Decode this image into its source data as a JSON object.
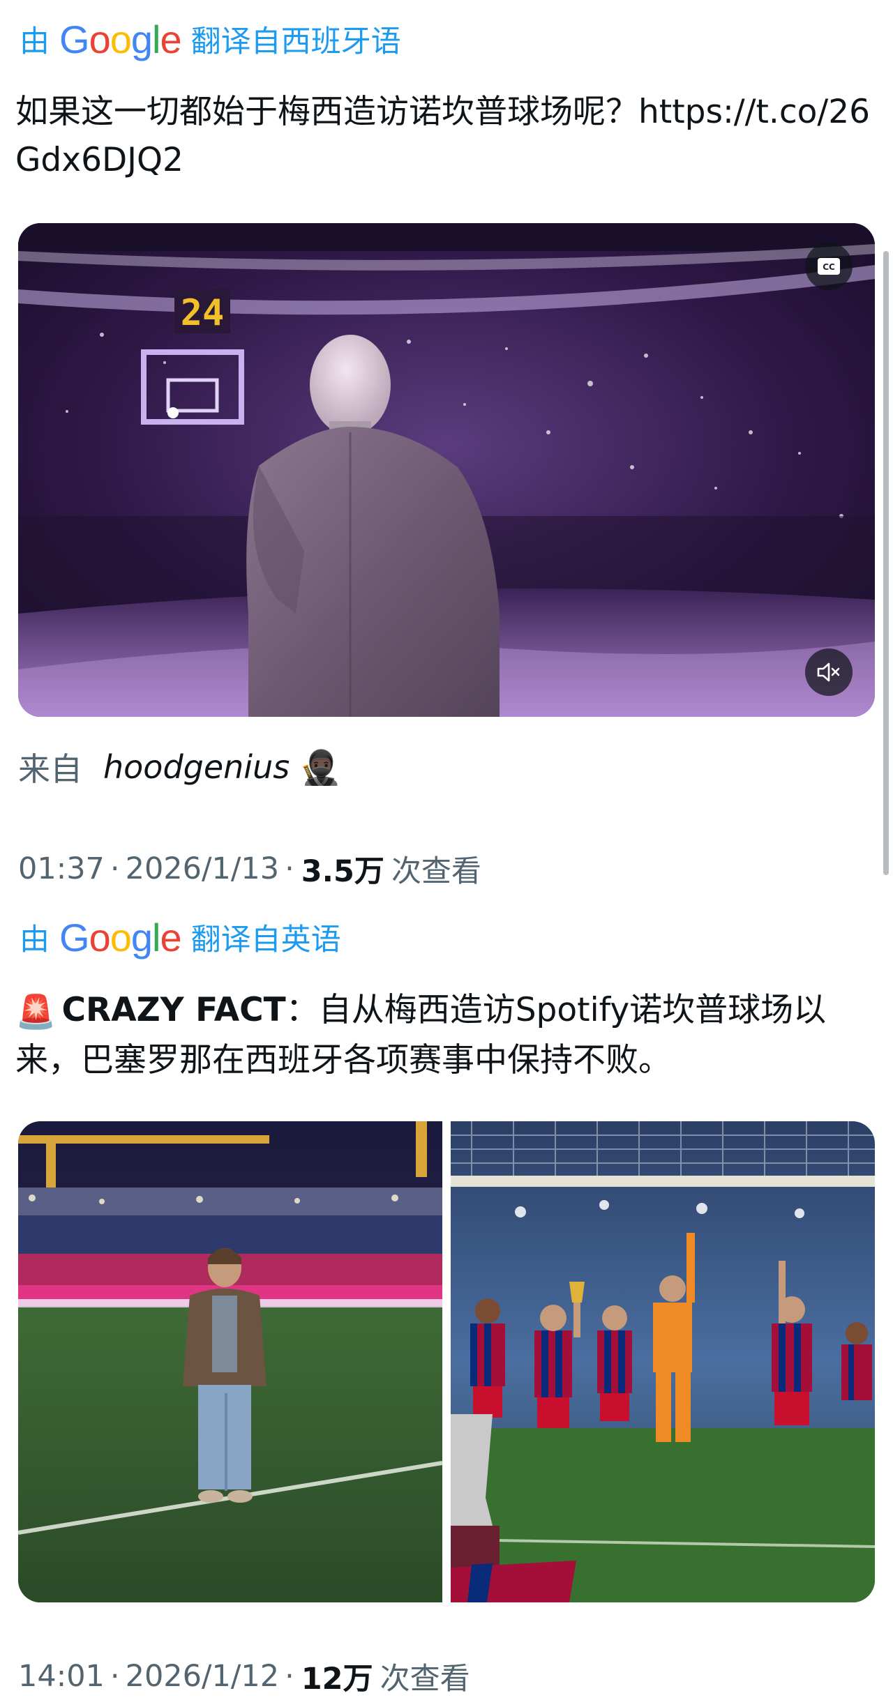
{
  "tweet1": {
    "translate_by": "由",
    "google_logo": "Google",
    "translate_from": "翻译自西班牙语",
    "text": "如果这一切都始于梅西造访诺坎普球场呢？https://t.co/26Gdx6DJQ2",
    "video": {
      "scoreboard_number": "24",
      "cc_icon": "closed-captions-icon",
      "mute_icon": "speaker-muted-icon"
    },
    "source_prefix": "来自",
    "source_user": "hoodgenius",
    "source_emoji": "🥷🏿",
    "time": "01:37",
    "date": "2026/1/13",
    "views": "3.5万",
    "views_label": "次查看"
  },
  "tweet2": {
    "translate_by": "由",
    "google_logo": "Google",
    "translate_from": "翻译自英语",
    "alert_emoji": "🚨",
    "headline": "CRAZY FACT",
    "colon": "：",
    "text": "自从梅西造访Spotify诺坎普球场以来，巴塞罗那在西班牙各项赛事中保持不败。",
    "images": [
      {
        "name": "messi-at-camp-nou-photo"
      },
      {
        "name": "barcelona-celebration-photo"
      }
    ],
    "time": "14:01",
    "date": "2026/1/12",
    "views": "12万",
    "views_label": "次查看"
  },
  "colors": {
    "accent": "#1d9bf0",
    "text_primary": "#0f1419",
    "text_secondary": "#536471",
    "google_blue": "#4285F4",
    "google_red": "#EA4335",
    "google_yellow": "#FBBC05",
    "google_green": "#34A853"
  }
}
